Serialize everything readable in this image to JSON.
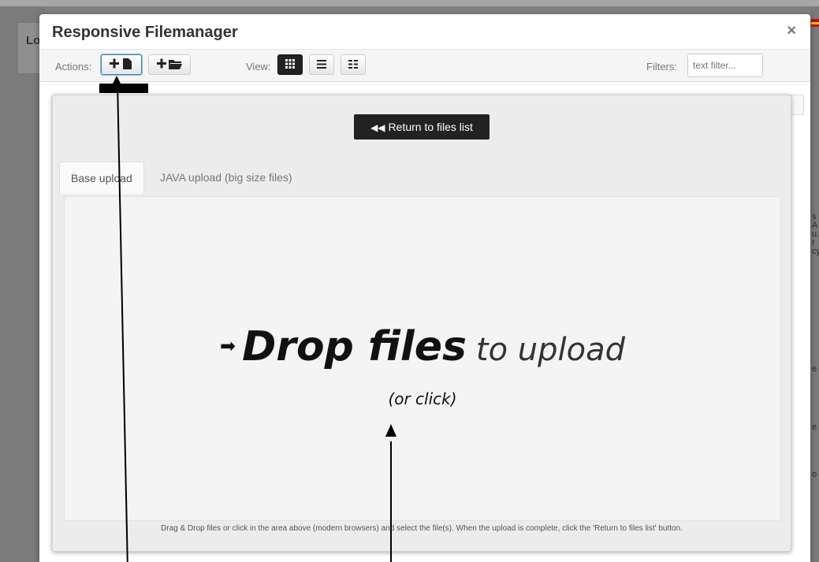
{
  "background": {
    "left_label": "Lo",
    "right_fragments": [
      "s",
      "A",
      "u.",
      "r",
      "cy",
      "e",
      "e",
      "o"
    ]
  },
  "modal": {
    "title": "Responsive Filemanager",
    "close": "×"
  },
  "toolbar": {
    "actions_label": "Actions:",
    "view_label": "View:",
    "filters_label": "Filters:",
    "filter_placeholder": "text filter...",
    "icons": {
      "upload_file": "plus-file-icon",
      "new_folder": "plus-folder-icon",
      "view_grid": "grid-icon",
      "view_list": "list-icon",
      "view_columns": "columns-list-icon"
    }
  },
  "upload": {
    "return_label": "Return to files list",
    "tabs": [
      {
        "label": "Base upload"
      },
      {
        "label": "JAVA upload (big size files)"
      }
    ],
    "drop_strong": "Drop files",
    "drop_light": "to upload",
    "drop_sub": "(or click)",
    "help": "Drag & Drop files or click in the area above (modern browsers) and select the file(s). When the upload is complete, click the 'Return to files list' button."
  },
  "colors": {
    "dark_button": "#222222",
    "active_border": "#3a87ad"
  }
}
